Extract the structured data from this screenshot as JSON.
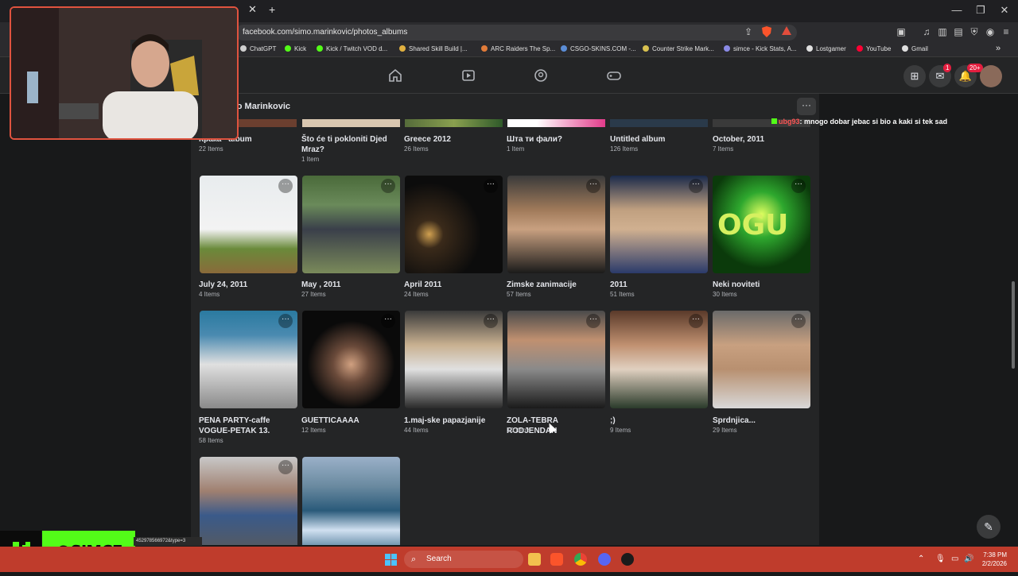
{
  "browser": {
    "url": "facebook.com/simo.marinkovic/photos_albums",
    "new_tab": "+",
    "tab_close": "✕",
    "window_min": "—",
    "window_max": "❐",
    "window_close": "✕",
    "bookmarks": [
      {
        "label": "ChatGPT",
        "color": "#cfcfcf"
      },
      {
        "label": "Kick",
        "color": "#53fc18"
      },
      {
        "label": "Kick / Twitch VOD d...",
        "color": "#53fc18"
      },
      {
        "label": "Shared Skill Build |...",
        "color": "#e0b040"
      },
      {
        "label": "ARC Raiders The Sp...",
        "color": "#e07b39"
      },
      {
        "label": "CSGO-SKINS.COM -...",
        "color": "#5b8dd6"
      },
      {
        "label": "Counter Strike Mark...",
        "color": "#d8c150"
      },
      {
        "label": "simce - Kick Stats, A...",
        "color": "#8a8ae6"
      },
      {
        "label": "Lostgamer",
        "color": "#e0e0e0"
      },
      {
        "label": "YouTube",
        "color": "#ff0033"
      },
      {
        "label": "Gmail",
        "color": "#e0e0e0"
      }
    ],
    "bookmarks_more": "»"
  },
  "header": {
    "messenger_badge": "1",
    "notifications_badge": "20+"
  },
  "profile": {
    "name": "mo Marinkovic",
    "more": "···"
  },
  "chat": {
    "username": "ubg93",
    "message": ": mnogo dobar jebac si bio a kaki si tek sad"
  },
  "partial_row": [
    {
      "title": "Крака - album",
      "count": "22 Items"
    },
    {
      "title": "Što će ti pokloniti Djed Mraz?",
      "count": "1 Item"
    },
    {
      "title": "Greece 2012",
      "count": "26 Items"
    },
    {
      "title": "Шта ти фали?",
      "count": "1 Item"
    },
    {
      "title": "Untitled album",
      "count": "126 Items"
    },
    {
      "title": "October, 2011",
      "count": "7 Items"
    }
  ],
  "albums_row1": [
    {
      "title": "July 24, 2011",
      "count": "4 Items"
    },
    {
      "title": "May , 2011",
      "count": "27 Items"
    },
    {
      "title": "April 2011",
      "count": "24 Items"
    },
    {
      "title": "Zimske zanimacije",
      "count": "57 Items"
    },
    {
      "title": "2011",
      "count": "51 Items"
    },
    {
      "title": "Neki noviteti",
      "count": "30 Items"
    }
  ],
  "albums_row2": [
    {
      "title": "PENA PARTY-caffe VOGUE-PETAK 13.",
      "count": "58 Items"
    },
    {
      "title": "GUETTICAAAA",
      "count": "12 Items"
    },
    {
      "title": "1.maj-ske papazjanije",
      "count": "44 Items"
    },
    {
      "title": "ZOLA-TEBRA RODJENDAN",
      "count": "10 Items"
    },
    {
      "title": ";)",
      "count": "9 Items"
    },
    {
      "title": "Sprdnjica...",
      "count": "29 Items"
    }
  ],
  "thumb_dots": "···",
  "thumb_text_ogu": "OGU",
  "overlay": {
    "kick_handle": "@SIMCE",
    "status_url": "452978566972&type=3"
  },
  "taskbar": {
    "search": "Search",
    "time": "7:38 PM",
    "date": "2/2/2026"
  },
  "colors": {
    "accent": "#e41e3f",
    "kick_green": "#53fc18",
    "taskbar": "#bf3c2c"
  }
}
